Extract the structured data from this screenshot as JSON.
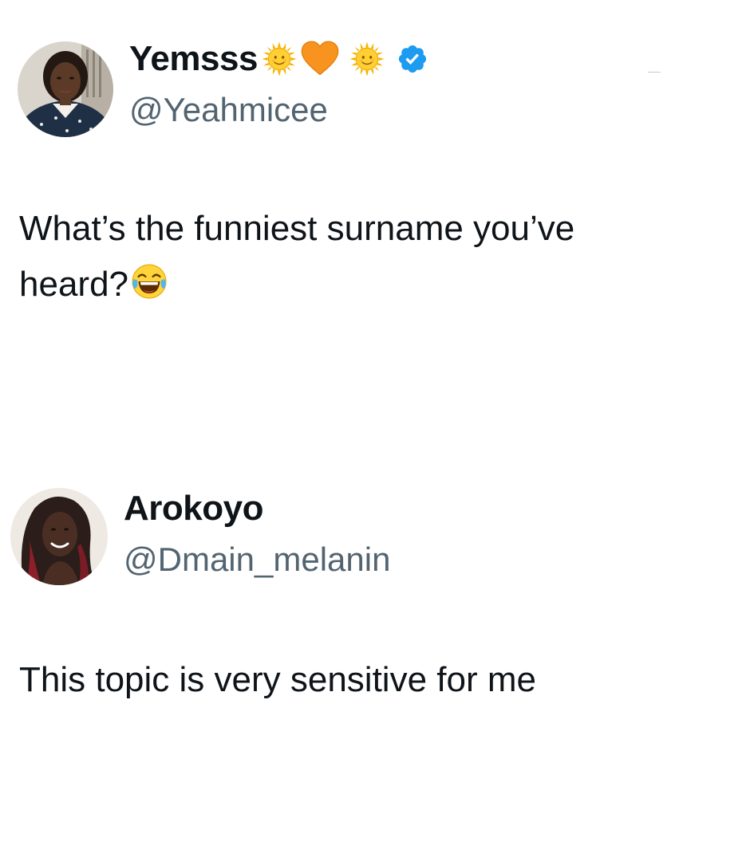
{
  "tweets": [
    {
      "display_name": "Yemsss",
      "name_emojis": [
        "sun-with-face-icon",
        "orange-heart-icon",
        "sun-with-face-icon"
      ],
      "verified": true,
      "handle": "@Yeahmicee",
      "text_line_1": "What’s the funniest surname you’ve",
      "text_line_2": "heard?",
      "text_emoji": "face-with-tears-of-joy-icon"
    },
    {
      "display_name": "Arokoyo",
      "verified": false,
      "handle": "@Dmain_melanin",
      "text": "This topic is very sensitive for me"
    }
  ],
  "colors": {
    "text": "#0f1419",
    "secondary_text": "#536471",
    "verified_blue": "#1d9bf0",
    "background": "#ffffff"
  }
}
